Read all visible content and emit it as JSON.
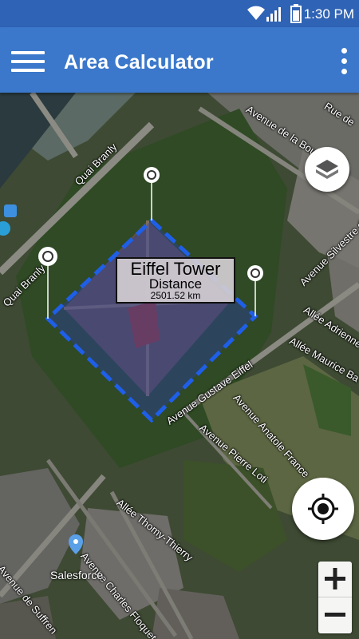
{
  "status_bar": {
    "time": "1:30 PM",
    "icons": [
      "wifi-icon",
      "signal-icon",
      "battery-icon"
    ]
  },
  "app_bar": {
    "title": "Area Calculator",
    "menu_icon": "hamburger-menu-icon",
    "overflow_icon": "more-vert-icon"
  },
  "colors": {
    "status_bar": "#2f63b5",
    "app_bar": "#3b78cb",
    "polygon_stroke": "#1f5fe8",
    "polygon_fill": "rgba(40,60,200,0.35)"
  },
  "measurement": {
    "title": "Eiffel Tower",
    "label": "Distance",
    "value": "2501.52 km"
  },
  "streets": {
    "quai_branly_1": "Quai Branly",
    "quai_branly_2": "Quai Branly",
    "avenue_bourdonnais": "Avenue de la Bourdonnais",
    "rue_de": "Rue de",
    "avenue_silvestre": "Avenue Silvestre de",
    "allee_adrienne": "Allée Adrienne Le",
    "allee_maurice": "Allée Maurice Ba",
    "avenue_gustave_eiffel": "Avenue Gustave Eiffel",
    "avenue_anatole_france": "Avenue Anatole France",
    "avenue_pierre_loti": "Avenue Pierre Loti",
    "allee_thomy": "Allée Thomy-Thierry",
    "avenue_charles_floquet": "Avenue Charles Floquet",
    "avenue_suffren": "Avenue de Suffren"
  },
  "poi": {
    "salesforce": "Salesforce"
  },
  "controls": {
    "layers_icon": "layers-icon",
    "locate_icon": "my-location-icon",
    "zoom_in": "+",
    "zoom_out": "−"
  }
}
